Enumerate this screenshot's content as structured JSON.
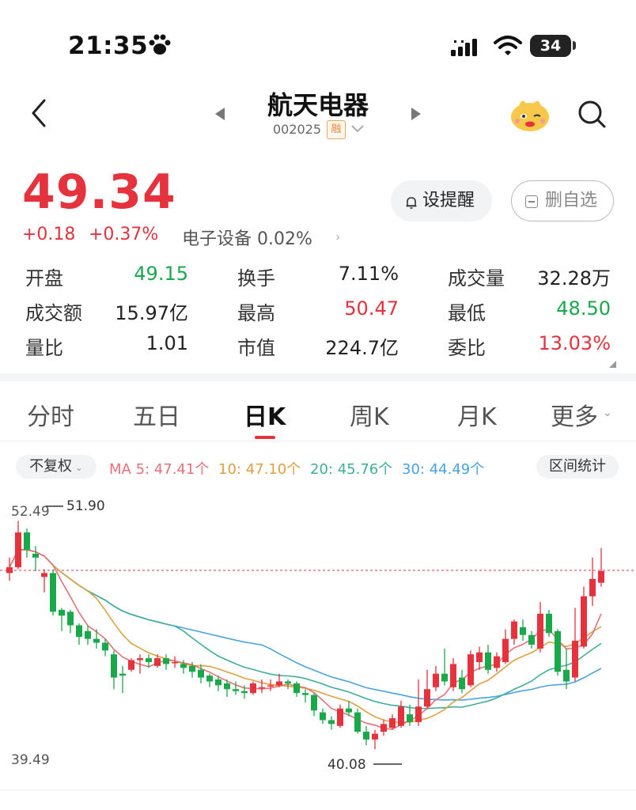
{
  "status_bar": {
    "time": "21:35",
    "battery": "34"
  },
  "header": {
    "name": "航天电器",
    "code": "002025",
    "badge": "融"
  },
  "quote": {
    "price": "49.34",
    "change": "+0.18",
    "change_pct": "+0.37%",
    "sector": "电子设备 0.02%",
    "alert_label": "设提醒",
    "remove_label": "删自选"
  },
  "stats": [
    {
      "label": "开盘",
      "value": "49.15",
      "color": "#19a84a"
    },
    {
      "label": "换手",
      "value": "7.11%",
      "color": "#222222"
    },
    {
      "label": "成交量",
      "value": "32.28万",
      "color": "#222222"
    },
    {
      "label": "成交额",
      "value": "15.97亿",
      "color": "#222222"
    },
    {
      "label": "最高",
      "value": "50.47",
      "color": "#e5323c"
    },
    {
      "label": "最低",
      "value": "48.50",
      "color": "#19a84a"
    },
    {
      "label": "量比",
      "value": "1.01",
      "color": "#222222"
    },
    {
      "label": "市值",
      "value": "224.7亿",
      "color": "#222222"
    },
    {
      "label": "委比",
      "value": "13.03%",
      "color": "#e5323c"
    }
  ],
  "tabs": [
    "分时",
    "五日",
    "日K",
    "周K",
    "月K",
    "更多"
  ],
  "indicators": {
    "adjust": "不复权",
    "ma5": "MA 5: 47.41个",
    "ma10": "10: 47.10个",
    "ma20": "20: 45.76个",
    "ma30": "30: 44.49个",
    "range": "区间统计"
  },
  "colors": {
    "up": "#e5323c",
    "down": "#19a84a",
    "ma5": "#e5727a",
    "ma10": "#e0a040",
    "ma20": "#3fae9a",
    "ma30": "#4aa3e0"
  },
  "chart_data": {
    "type": "candlestick",
    "y_axis": {
      "top": "52.49",
      "bottom": "39.49"
    },
    "ylim": [
      39.49,
      52.49
    ],
    "annotations": {
      "high": "51.90",
      "low": "40.08"
    },
    "current_price": 49.34,
    "candles": [
      [
        49.2,
        49.5,
        50.0,
        48.8
      ],
      [
        49.5,
        51.3,
        51.9,
        49.4
      ],
      [
        51.3,
        50.4,
        51.5,
        50.0
      ],
      [
        50.2,
        50.0,
        50.6,
        49.3
      ],
      [
        49.0,
        49.2,
        49.4,
        48.2
      ],
      [
        49.2,
        47.2,
        49.4,
        47.0
      ],
      [
        47.3,
        47.0,
        47.4,
        46.2
      ],
      [
        47.2,
        46.5,
        47.3,
        46.1
      ],
      [
        46.5,
        45.9,
        46.6,
        45.5
      ],
      [
        46.2,
        45.8,
        46.5,
        45.5
      ],
      [
        45.8,
        45.6,
        46.3,
        45.3
      ],
      [
        45.6,
        45.2,
        45.8,
        44.9
      ],
      [
        45.0,
        43.8,
        45.2,
        43.2
      ],
      [
        44.0,
        43.9,
        44.4,
        43.0
      ],
      [
        44.2,
        44.7,
        44.8,
        44.1
      ],
      [
        44.7,
        44.8,
        45.0,
        44.0
      ],
      [
        44.8,
        44.6,
        45.0,
        44.3
      ],
      [
        44.4,
        44.8,
        45.0,
        44.3
      ],
      [
        44.8,
        44.5,
        45.0,
        44.2
      ],
      [
        44.6,
        44.6,
        44.9,
        44.3
      ],
      [
        44.5,
        44.3,
        44.7,
        44.0
      ],
      [
        44.4,
        44.1,
        44.6,
        43.8
      ],
      [
        44.2,
        43.8,
        44.5,
        43.5
      ],
      [
        43.9,
        43.6,
        44.0,
        43.3
      ],
      [
        43.7,
        43.4,
        43.9,
        43.1
      ],
      [
        43.5,
        43.2,
        43.7,
        42.8
      ],
      [
        43.2,
        43.1,
        43.6,
        42.9
      ],
      [
        43.1,
        43.0,
        43.4,
        42.7
      ],
      [
        43.0,
        43.5,
        43.6,
        42.9
      ],
      [
        43.3,
        43.3,
        43.7,
        43.0
      ],
      [
        43.4,
        43.4,
        43.7,
        43.1
      ],
      [
        43.4,
        43.6,
        44.0,
        43.3
      ],
      [
        43.6,
        43.5,
        43.7,
        43.2
      ],
      [
        43.5,
        43.0,
        43.6,
        42.8
      ],
      [
        43.0,
        42.9,
        43.2,
        42.5
      ],
      [
        42.9,
        42.1,
        43.0,
        41.8
      ],
      [
        42.0,
        41.6,
        42.2,
        41.4
      ],
      [
        41.6,
        41.4,
        41.8,
        41.1
      ],
      [
        41.3,
        42.2,
        42.4,
        41.2
      ],
      [
        42.2,
        42.0,
        42.6,
        41.8
      ],
      [
        42.0,
        41.0,
        42.2,
        40.9
      ],
      [
        41.0,
        40.6,
        41.3,
        40.3
      ],
      [
        40.6,
        40.9,
        41.1,
        40.1
      ],
      [
        41.0,
        41.4,
        41.6,
        40.8
      ],
      [
        41.2,
        41.7,
        41.9,
        41.1
      ],
      [
        41.3,
        42.3,
        42.6,
        41.2
      ],
      [
        41.9,
        41.5,
        42.4,
        41.3
      ],
      [
        41.5,
        42.3,
        43.7,
        41.3
      ],
      [
        42.3,
        43.2,
        44.2,
        42.2
      ],
      [
        43.3,
        44.0,
        44.4,
        43.1
      ],
      [
        44.0,
        43.6,
        45.3,
        43.4
      ],
      [
        43.3,
        44.5,
        44.8,
        43.1
      ],
      [
        43.8,
        43.2,
        44.2,
        43.0
      ],
      [
        43.4,
        45.0,
        45.2,
        43.3
      ],
      [
        44.6,
        45.1,
        45.4,
        44.2
      ],
      [
        45.1,
        44.2,
        45.5,
        44.0
      ],
      [
        44.3,
        44.9,
        45.1,
        44.1
      ],
      [
        44.6,
        45.8,
        46.3,
        44.5
      ],
      [
        45.8,
        46.7,
        46.8,
        45.5
      ],
      [
        46.4,
        46.0,
        46.8,
        45.7
      ],
      [
        46.0,
        45.5,
        46.2,
        45.3
      ],
      [
        45.3,
        47.1,
        47.7,
        45.1
      ],
      [
        47.1,
        46.1,
        47.3,
        45.9
      ],
      [
        46.2,
        44.1,
        46.3,
        43.9
      ],
      [
        44.2,
        43.6,
        45.3,
        43.2
      ],
      [
        43.8,
        45.7,
        47.4,
        43.6
      ],
      [
        45.4,
        48.0,
        48.5,
        45.3
      ],
      [
        48.0,
        48.9,
        50.0,
        47.5
      ],
      [
        48.7,
        49.3,
        50.5,
        48.5
      ]
    ],
    "ma5": [
      50.4,
      50.3,
      49.6,
      48.8,
      48.2,
      47.5,
      46.9,
      46.5,
      46.0,
      45.7,
      45.4,
      45.1,
      44.8,
      44.6,
      44.5,
      44.5,
      44.5,
      44.5,
      44.5,
      44.4,
      44.3,
      44.2,
      44.0,
      43.8,
      43.6,
      43.4,
      43.3,
      43.2,
      43.2,
      43.3,
      43.3,
      43.3,
      43.2,
      43.0,
      42.7,
      42.3,
      41.9,
      41.6,
      41.5,
      41.3,
      41.1,
      41.0,
      41.0,
      41.2,
      41.6,
      42.0,
      42.4,
      42.8,
      43.3,
      43.6,
      43.8,
      44.0,
      44.1,
      44.3,
      44.5,
      44.8,
      45.1,
      45.4,
      45.6,
      45.6,
      45.3,
      45.0,
      45.3,
      45.9,
      46.6,
      47.4
    ]
  }
}
